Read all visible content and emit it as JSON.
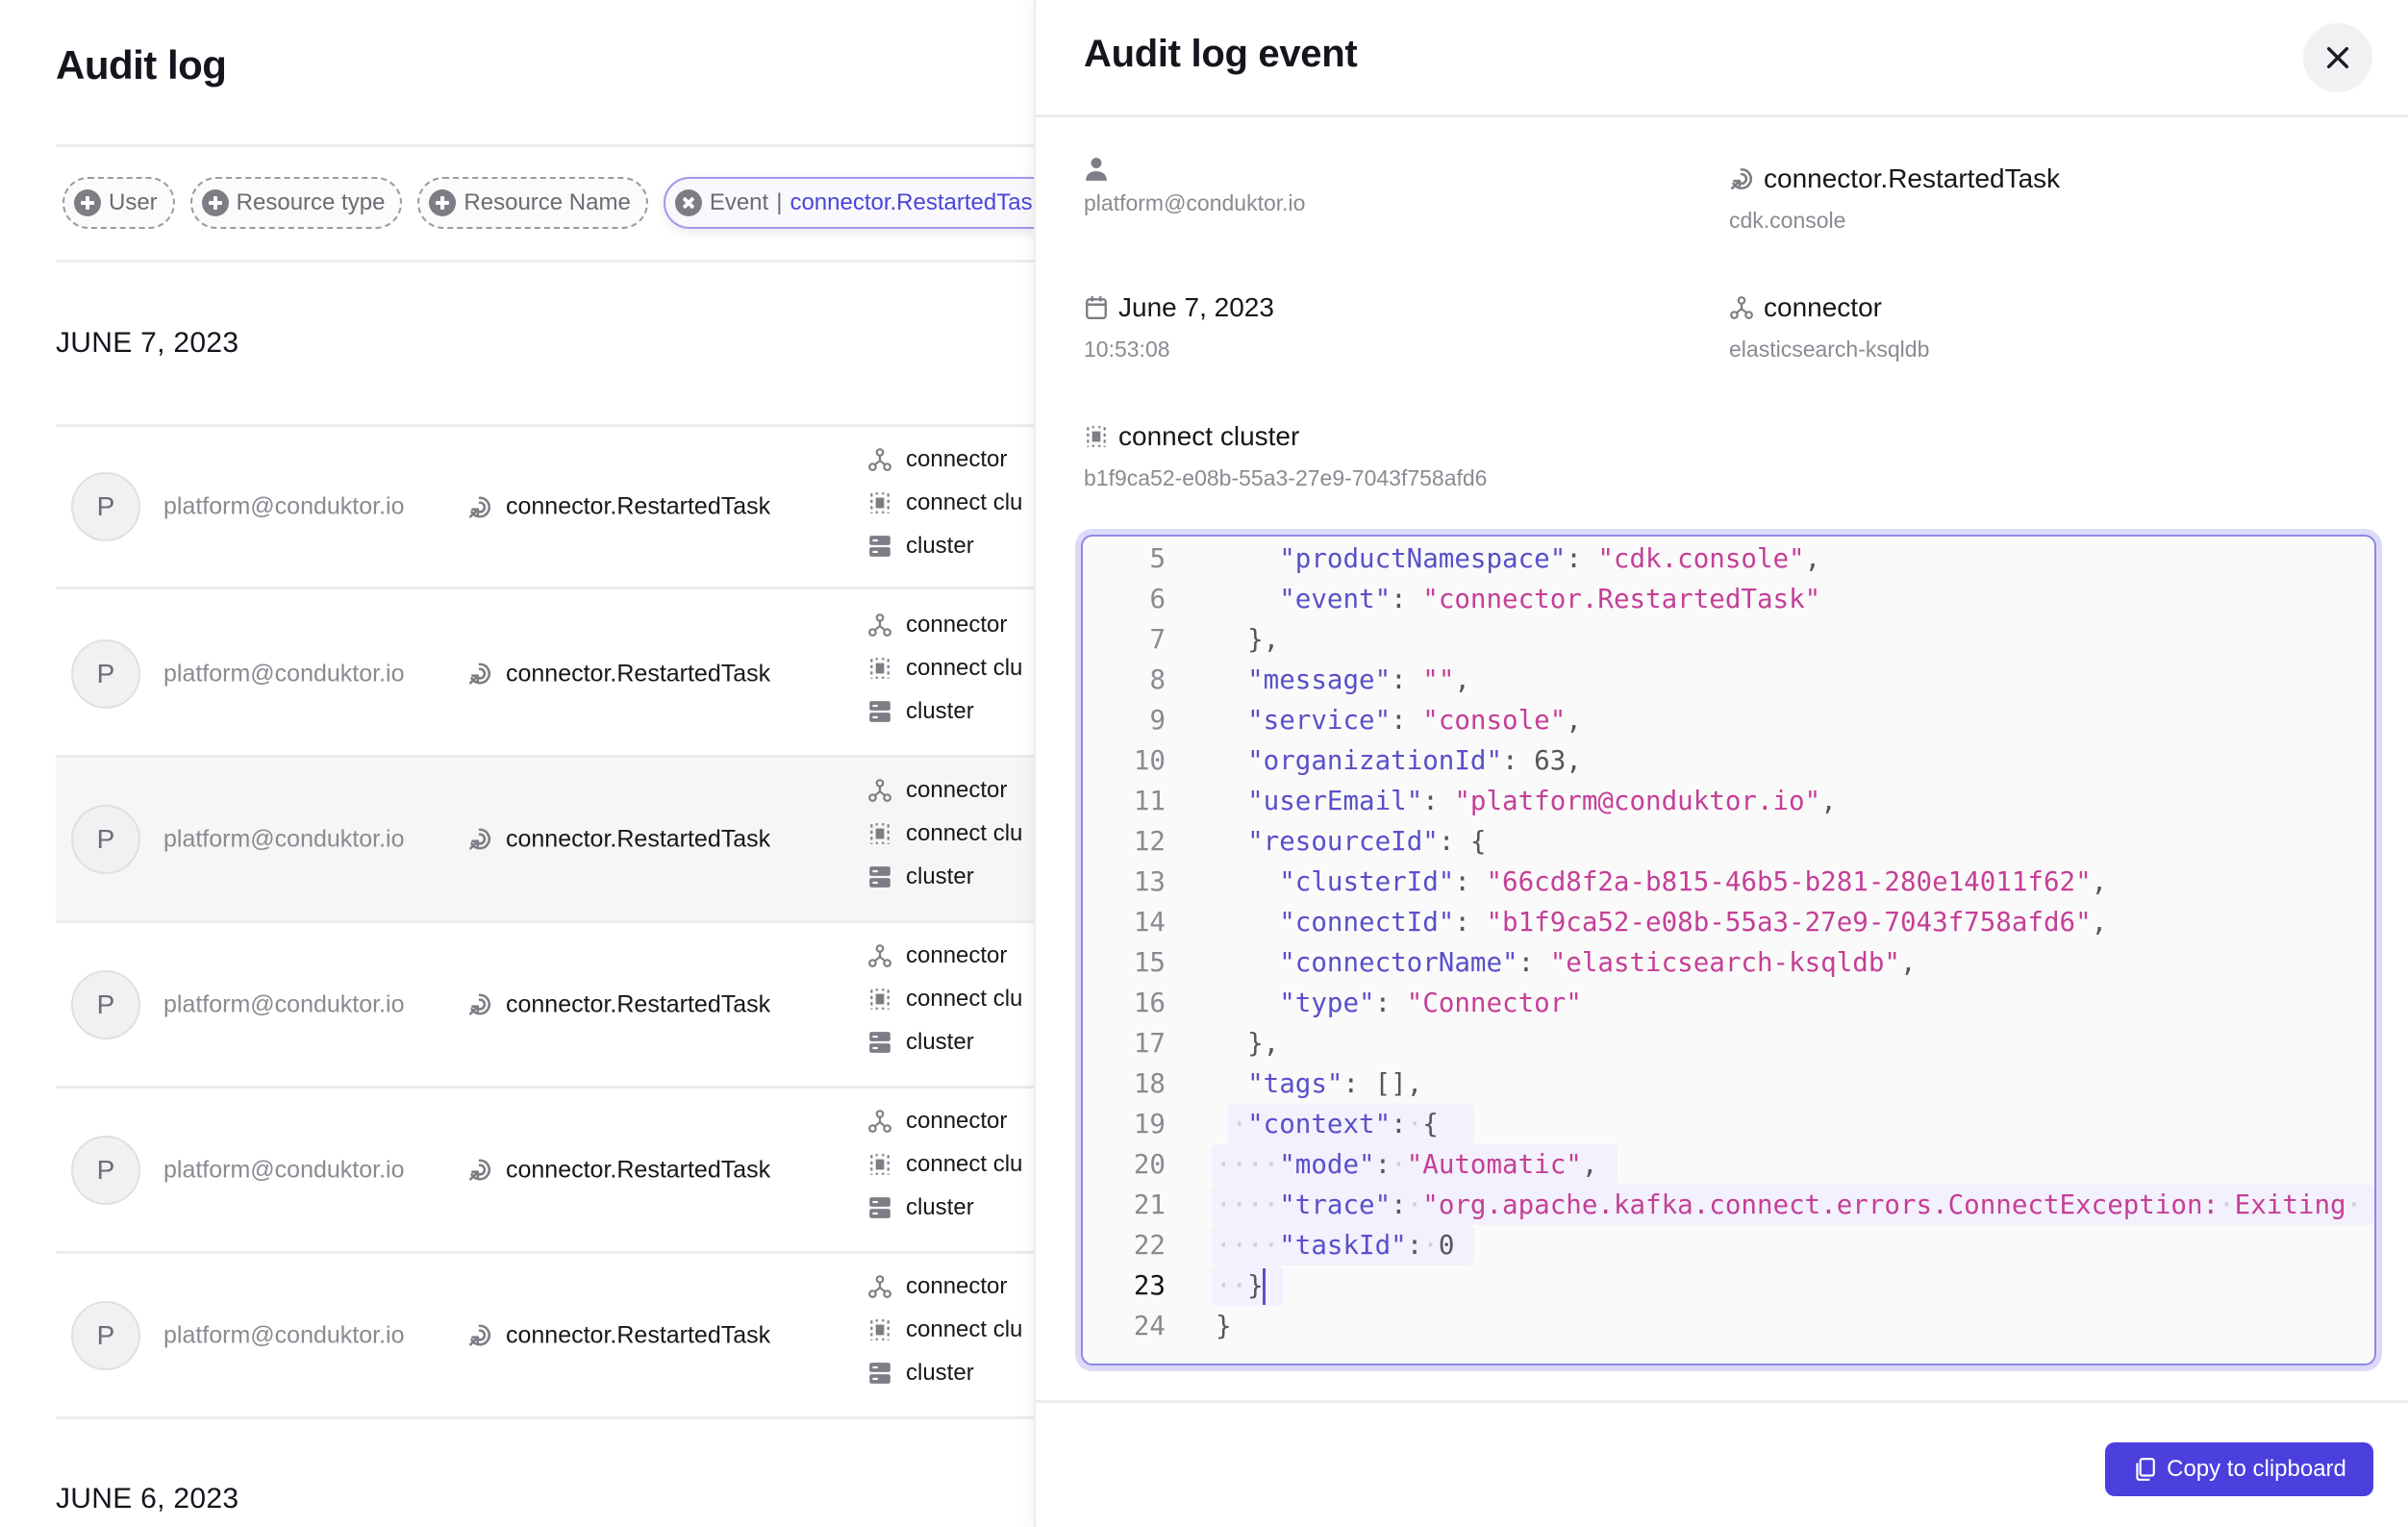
{
  "page": {
    "title": "Audit log",
    "filters": [
      {
        "label": "User",
        "icon": "plus-circle-icon",
        "active": false
      },
      {
        "label": "Resource type",
        "icon": "plus-circle-icon",
        "active": false
      },
      {
        "label": "Resource Name",
        "icon": "plus-circle-icon",
        "active": false
      },
      {
        "label": "Event",
        "separator": "|",
        "value": "connector.RestartedTask",
        "icon": "close-circle-icon",
        "active": true
      }
    ],
    "groups": [
      {
        "date": "JUNE 7, 2023",
        "rows": [
          {
            "avatar": "P",
            "email": "platform@conduktor.io",
            "event": "connector.RestartedTask",
            "resources": [
              "connector",
              "connect clu",
              "cluster"
            ]
          },
          {
            "avatar": "P",
            "email": "platform@conduktor.io",
            "event": "connector.RestartedTask",
            "resources": [
              "connector",
              "connect clu",
              "cluster"
            ]
          },
          {
            "avatar": "P",
            "email": "platform@conduktor.io",
            "event": "connector.RestartedTask",
            "resources": [
              "connector",
              "connect clu",
              "cluster"
            ]
          },
          {
            "avatar": "P",
            "email": "platform@conduktor.io",
            "event": "connector.RestartedTask",
            "resources": [
              "connector",
              "connect clu",
              "cluster"
            ]
          },
          {
            "avatar": "P",
            "email": "platform@conduktor.io",
            "event": "connector.RestartedTask",
            "resources": [
              "connector",
              "connect clu",
              "cluster"
            ]
          },
          {
            "avatar": "P",
            "email": "platform@conduktor.io",
            "event": "connector.RestartedTask",
            "resources": [
              "connector",
              "connect clu",
              "cluster"
            ]
          }
        ]
      },
      {
        "date": "JUNE 6, 2023",
        "rows": []
      }
    ],
    "highlighted_row": 2
  },
  "panel": {
    "title": "Audit log event",
    "close_icon": "close-icon",
    "fields": {
      "user": {
        "icon": "user-icon",
        "label": "",
        "value": "platform@conduktor.io"
      },
      "event": {
        "icon": "event-restart-icon",
        "label": "connector.RestartedTask",
        "value": "cdk.console"
      },
      "date": {
        "icon": "calendar-icon",
        "label": "June 7, 2023",
        "value": "10:53:08"
      },
      "connector": {
        "icon": "connector-icon",
        "label": "connector",
        "value": "elasticsearch-ksqldb"
      },
      "connect_cluster": {
        "icon": "connect-cluster-icon",
        "label": "connect cluster",
        "value": "b1f9ca52-e08b-55a3-27e9-7043f758afd6"
      }
    },
    "editor": {
      "current_line": 23,
      "lines": [
        {
          "n": "5",
          "indent": 4,
          "tokens": [
            [
              "k",
              "\"productNamespace\""
            ],
            [
              "p",
              ": "
            ],
            [
              "s",
              "\"cdk.console\""
            ],
            [
              "p",
              ","
            ]
          ]
        },
        {
          "n": "6",
          "indent": 4,
          "tokens": [
            [
              "k",
              "\"event\""
            ],
            [
              "p",
              ": "
            ],
            [
              "s",
              "\"connector.RestartedTask\""
            ]
          ]
        },
        {
          "n": "7",
          "indent": 2,
          "tokens": [
            [
              "p",
              "},"
            ]
          ]
        },
        {
          "n": "8",
          "indent": 2,
          "tokens": [
            [
              "k",
              "\"message\""
            ],
            [
              "p",
              ": "
            ],
            [
              "s",
              "\"\""
            ],
            [
              "p",
              ","
            ]
          ]
        },
        {
          "n": "9",
          "indent": 2,
          "tokens": [
            [
              "k",
              "\"service\""
            ],
            [
              "p",
              ": "
            ],
            [
              "s",
              "\"console\""
            ],
            [
              "p",
              ","
            ]
          ]
        },
        {
          "n": "10",
          "indent": 2,
          "tokens": [
            [
              "k",
              "\"organizationId\""
            ],
            [
              "p",
              ": "
            ],
            [
              "n",
              "63"
            ],
            [
              "p",
              ","
            ]
          ]
        },
        {
          "n": "11",
          "indent": 2,
          "tokens": [
            [
              "k",
              "\"userEmail\""
            ],
            [
              "p",
              ": "
            ],
            [
              "s",
              "\"platform@conduktor.io\""
            ],
            [
              "p",
              ","
            ]
          ]
        },
        {
          "n": "12",
          "indent": 2,
          "tokens": [
            [
              "k",
              "\"resourceId\""
            ],
            [
              "p",
              ": {"
            ]
          ]
        },
        {
          "n": "13",
          "indent": 4,
          "tokens": [
            [
              "k",
              "\"clusterId\""
            ],
            [
              "p",
              ": "
            ],
            [
              "s",
              "\"66cd8f2a-b815-46b5-b281-280e14011f62\""
            ],
            [
              "p",
              ","
            ]
          ]
        },
        {
          "n": "14",
          "indent": 4,
          "tokens": [
            [
              "k",
              "\"connectId\""
            ],
            [
              "p",
              ": "
            ],
            [
              "s",
              "\"b1f9ca52-e08b-55a3-27e9-7043f758afd6\""
            ],
            [
              "p",
              ","
            ]
          ]
        },
        {
          "n": "15",
          "indent": 4,
          "tokens": [
            [
              "k",
              "\"connectorName\""
            ],
            [
              "p",
              ": "
            ],
            [
              "s",
              "\"elasticsearch-ksqldb\""
            ],
            [
              "p",
              ","
            ]
          ]
        },
        {
          "n": "16",
          "indent": 4,
          "tokens": [
            [
              "k",
              "\"type\""
            ],
            [
              "p",
              ": "
            ],
            [
              "s",
              "\"Connector\""
            ]
          ]
        },
        {
          "n": "17",
          "indent": 2,
          "tokens": [
            [
              "p",
              "},"
            ]
          ]
        },
        {
          "n": "18",
          "indent": 2,
          "tokens": [
            [
              "k",
              "\"tags\""
            ],
            [
              "p",
              ": [],"
            ]
          ]
        },
        {
          "n": "19",
          "indent": 2,
          "ws": true,
          "hl": true,
          "tokens": [
            [
              "k",
              "\"context\""
            ],
            [
              "p",
              ":"
            ],
            [
              "ws",
              "·"
            ],
            [
              "p",
              "{"
            ]
          ]
        },
        {
          "n": "20",
          "indent": 4,
          "ws": true,
          "hl": true,
          "tokens": [
            [
              "k",
              "\"mode\""
            ],
            [
              "p",
              ":"
            ],
            [
              "ws",
              "·"
            ],
            [
              "s",
              "\"Automatic\""
            ],
            [
              "p",
              ","
            ]
          ]
        },
        {
          "n": "21",
          "indent": 4,
          "ws": true,
          "hl": true,
          "tokens": [
            [
              "k",
              "\"trace\""
            ],
            [
              "p",
              ":"
            ],
            [
              "ws",
              "·"
            ],
            [
              "s",
              "\"org.apache.kafka.connect.errors.ConnectException:"
            ],
            [
              "ws",
              "·"
            ],
            [
              "s",
              "Exiting"
            ],
            [
              "ws",
              "·"
            ]
          ]
        },
        {
          "n": "22",
          "indent": 4,
          "ws": true,
          "hl": true,
          "tokens": [
            [
              "k",
              "\"taskId\""
            ],
            [
              "p",
              ":"
            ],
            [
              "ws",
              "·"
            ],
            [
              "n",
              "0"
            ]
          ]
        },
        {
          "n": "23",
          "indent": 2,
          "ws": true,
          "hl": true,
          "cursor": true,
          "tokens": [
            [
              "p",
              "}"
            ]
          ]
        },
        {
          "n": "24",
          "indent": 0,
          "tokens": [
            [
              "p",
              "}"
            ]
          ]
        }
      ]
    },
    "copy_button": {
      "label": "Copy to clipboard",
      "icon": "copy-icon"
    }
  },
  "colors": {
    "accent": "#4b3fde",
    "filter_value": "#4a45d9",
    "json_key": "#5a4fc9",
    "json_string": "#c53f97",
    "muted_text": "#8a8a92",
    "row_highlight": "#f6f6f6"
  }
}
